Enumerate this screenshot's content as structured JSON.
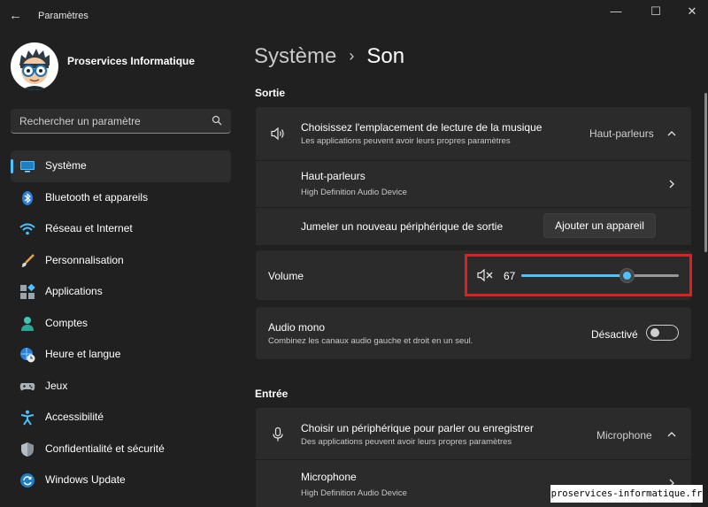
{
  "window": {
    "title": "Paramètres",
    "back_glyph": "←",
    "minimize_glyph": "—",
    "maximize_glyph": "☐",
    "close_glyph": "✕"
  },
  "account": {
    "name": "Proservices Informatique"
  },
  "search": {
    "placeholder": "Rechercher un paramètre"
  },
  "sidebar": {
    "items": [
      {
        "label": "Système",
        "icon": "monitor-icon",
        "active": true
      },
      {
        "label": "Bluetooth et appareils",
        "icon": "bluetooth-icon",
        "active": false
      },
      {
        "label": "Réseau et Internet",
        "icon": "wifi-icon",
        "active": false
      },
      {
        "label": "Personnalisation",
        "icon": "brush-icon",
        "active": false
      },
      {
        "label": "Applications",
        "icon": "apps-icon",
        "active": false
      },
      {
        "label": "Comptes",
        "icon": "person-icon",
        "active": false
      },
      {
        "label": "Heure et langue",
        "icon": "globe-clock-icon",
        "active": false
      },
      {
        "label": "Jeux",
        "icon": "gamepad-icon",
        "active": false
      },
      {
        "label": "Accessibilité",
        "icon": "accessibility-icon",
        "active": false
      },
      {
        "label": "Confidentialité et sécurité",
        "icon": "shield-icon",
        "active": false
      },
      {
        "label": "Windows Update",
        "icon": "update-icon",
        "active": false
      }
    ]
  },
  "breadcrumb": {
    "parent": "Système",
    "separator": "›",
    "current": "Son"
  },
  "output": {
    "section_label": "Sortie",
    "location": {
      "title": "Choisissez l'emplacement de lecture de la musique",
      "subtitle": "Les applications peuvent avoir leurs propres paramètres",
      "value": "Haut-parleurs"
    },
    "device": {
      "title": "Haut-parleurs",
      "subtitle": "High Definition Audio Device"
    },
    "pair": {
      "title": "Jumeler un nouveau périphérique de sortie",
      "button": "Ajouter un appareil"
    },
    "volume": {
      "label": "Volume",
      "value": "67",
      "level": 0.67
    },
    "mono": {
      "title": "Audio mono",
      "subtitle": "Combinez les canaux audio gauche et droit en un seul.",
      "state": "Désactivé",
      "on": false
    }
  },
  "input": {
    "section_label": "Entrée",
    "choose": {
      "title": "Choisir un périphérique pour parler ou enregistrer",
      "subtitle": "Des applications peuvent avoir leurs propres paramètres",
      "value": "Microphone"
    },
    "device": {
      "title": "Microphone",
      "subtitle": "High Definition Audio Device"
    }
  },
  "colors": {
    "accent": "#4cc2ff",
    "highlight": "#e02020",
    "background": "#202020",
    "card": "#2b2b2b"
  },
  "watermark": "proservices-informatique.fr"
}
